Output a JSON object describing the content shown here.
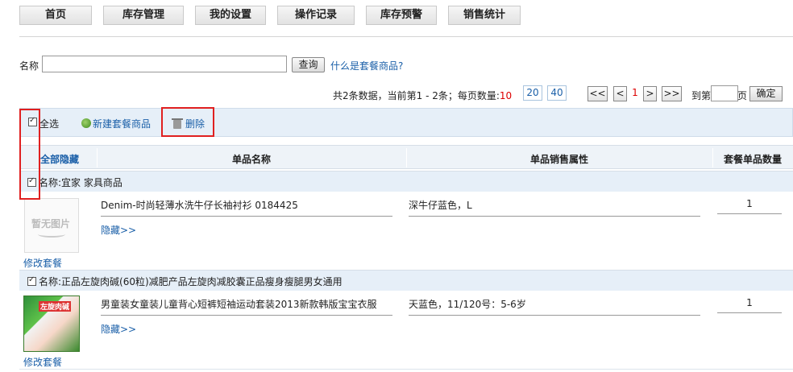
{
  "nav": {
    "items": [
      "首页",
      "库存管理",
      "我的设置",
      "操作记录",
      "库存预警",
      "销售统计"
    ]
  },
  "search": {
    "label": "名称",
    "value": "",
    "button": "查询",
    "help_link": "什么是套餐商品?"
  },
  "pagination": {
    "info_prefix": "共2条数据，当前第1 - 2条；每页数量:",
    "sizes": [
      "10",
      "20",
      "40"
    ],
    "first": "<<",
    "prev": "<",
    "current": "1",
    "next": ">",
    "last": ">>",
    "goto_label": "到第",
    "goto_value": "",
    "goto_suffix": "页",
    "confirm": "确定"
  },
  "toolbar": {
    "select_all": "全选",
    "new_combo": "新建套餐商品",
    "delete": "删除"
  },
  "table": {
    "headers": {
      "hide_all": "全部隐藏",
      "name": "单品名称",
      "attr": "单品销售属性",
      "qty": "套餐单品数量"
    },
    "groups": [
      {
        "title": "名称:宜家 家具商品",
        "image_placeholder": "暂无图片",
        "product_name": "Denim-时尚轻薄水洗牛仔长袖衬衫 0184425",
        "product_attr": "深牛仔蓝色，L",
        "qty": "1",
        "hide": "隐藏>>",
        "edit": "修改套餐"
      },
      {
        "title": "名称:正品左旋肉碱(60粒)减肥产品左旋肉减胶囊正品瘦身瘦腿男女通用",
        "image_text": "左旋肉碱",
        "product_name": "男童装女童装儿童背心短裤短袖运动套装2013新款韩版宝宝衣服",
        "product_attr": "天蓝色，11/120号：5-6岁",
        "qty": "1",
        "hide": "隐藏>>",
        "edit": "修改套餐"
      }
    ]
  }
}
